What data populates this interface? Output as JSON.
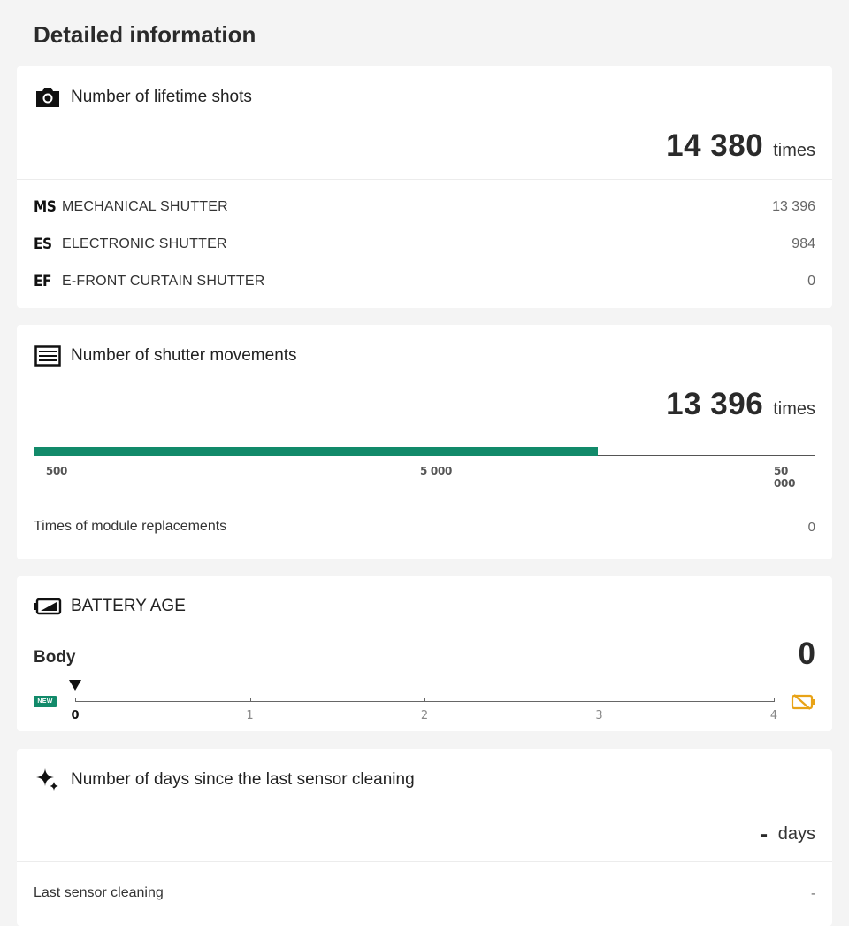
{
  "page": {
    "title": "Detailed information"
  },
  "lifetime": {
    "title": "Number of lifetime shots",
    "icon": "camera-icon",
    "value": "14 380",
    "unit": "times",
    "rows": [
      {
        "abbr": "MS",
        "label": "MECHANICAL SHUTTER",
        "value": "13 396"
      },
      {
        "abbr": "ES",
        "label": "ELECTRONIC SHUTTER",
        "value": "984"
      },
      {
        "abbr": "EF",
        "label": "E-FRONT CURTAIN SHUTTER",
        "value": "0"
      }
    ]
  },
  "shutter": {
    "title": "Number of shutter movements",
    "icon": "shutter-icon",
    "value": "13 396",
    "unit": "times",
    "fill_fraction": 0.722,
    "scale_labels": [
      "500",
      "5 000",
      "50 000"
    ],
    "module_label": "Times of module replacements",
    "module_value": "0"
  },
  "battery": {
    "title": "BATTERY AGE",
    "icon": "battery-icon",
    "body_label": "Body",
    "value": "0",
    "new_badge": "NEW",
    "scale": [
      "0",
      "1",
      "2",
      "3",
      "4"
    ],
    "current_level": 0,
    "accent_color": "#e8a317"
  },
  "sensor": {
    "title": "Number of days since the last sensor cleaning",
    "icon": "sparkle-icon",
    "value": "-",
    "unit": "days",
    "last_label": "Last sensor cleaning",
    "last_value": "-"
  },
  "colors": {
    "accent": "#128a6a",
    "warning": "#e8a317",
    "background": "#f4f4f4"
  }
}
